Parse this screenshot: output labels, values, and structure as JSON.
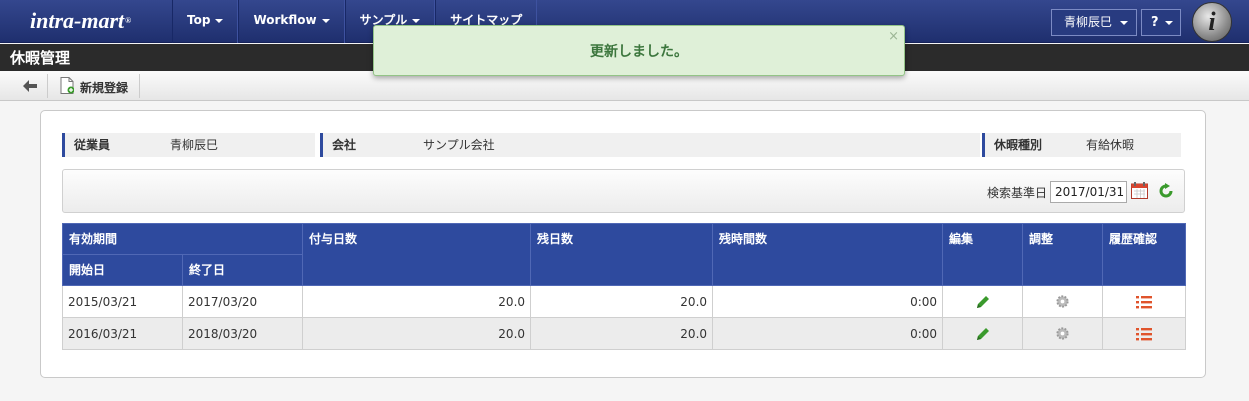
{
  "navbar": {
    "logo": "intra-mart",
    "logo_mark": "®",
    "items": [
      {
        "label": "Top"
      },
      {
        "label": "Workflow"
      },
      {
        "label": "サンプル"
      },
      {
        "label": "サイトマップ"
      }
    ],
    "user": "青柳辰巳",
    "help": "?",
    "brand_letter": "i"
  },
  "page_title": "休暇管理",
  "toolbar": {
    "back_icon": "arrow-left-icon",
    "new_label": "新規登録"
  },
  "toast": {
    "message": "更新しました。",
    "close": "×"
  },
  "info": {
    "employee_label": "従業員",
    "employee_value": "青柳辰巳",
    "company_label": "会社",
    "company_value": "サンプル会社",
    "leave_type_label": "休暇種別",
    "leave_type_value": "有給休暇"
  },
  "search": {
    "label": "検索基準日",
    "date": "2017/01/31"
  },
  "table": {
    "headers": {
      "period": "有効期間",
      "start": "開始日",
      "end": "終了日",
      "granted": "付与日数",
      "remaining_days": "残日数",
      "remaining_hours": "残時間数",
      "edit": "編集",
      "adjust": "調整",
      "history": "履歴確認"
    },
    "rows": [
      {
        "start": "2015/03/21",
        "end": "2017/03/20",
        "granted": "20.0",
        "remaining_days": "20.0",
        "remaining_hours": "0:00"
      },
      {
        "start": "2016/03/21",
        "end": "2018/03/20",
        "granted": "20.0",
        "remaining_days": "20.0",
        "remaining_hours": "0:00"
      }
    ]
  },
  "colors": {
    "nav_bg": "#2b3d82",
    "header_bg": "#2e4a9e",
    "toast_bg": "#dff0d8",
    "toast_text": "#3c763d",
    "pencil": "#3a9a2c",
    "list_icon": "#e0542c"
  }
}
